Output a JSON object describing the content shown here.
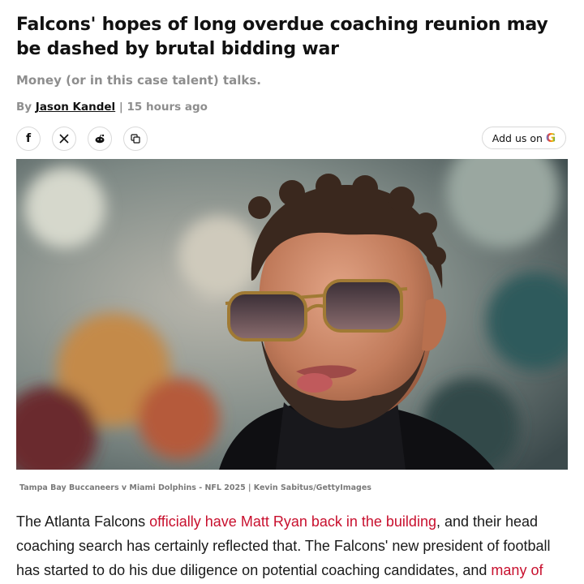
{
  "article": {
    "headline": "Falcons' hopes of long overdue coaching reunion may be dashed by brutal bidding war",
    "dek": "Money (or in this case talent) talks.",
    "byline": {
      "prefix": "By ",
      "author": "Jason Kandel",
      "separator": " | ",
      "time": "15 hours ago"
    },
    "share_buttons": [
      {
        "icon": "facebook-icon",
        "glyph": "f"
      },
      {
        "icon": "x-icon",
        "glyph": "𝕏"
      },
      {
        "icon": "reddit-icon",
        "glyph": ""
      },
      {
        "icon": "copy-link-icon",
        "glyph": ""
      }
    ],
    "add_us": {
      "label": "Add us on",
      "brand_glyph": "G"
    },
    "image_caption": "Tampa Bay Buccaneers v Miami Dolphins - NFL 2025 | Kevin Sabitus/GettyImages",
    "body": {
      "t1": "The Atlanta Falcons ",
      "link1": "officially have Matt Ryan back in the building",
      "t2": ", and their head coaching search has certainly reflected that. The Falcons' new president of football has started to do his due diligence on potential coaching candidates, and ",
      "link2": "many of"
    }
  },
  "colors": {
    "link": "#c8102e",
    "muted": "#8e8e8e",
    "text": "#111111"
  }
}
